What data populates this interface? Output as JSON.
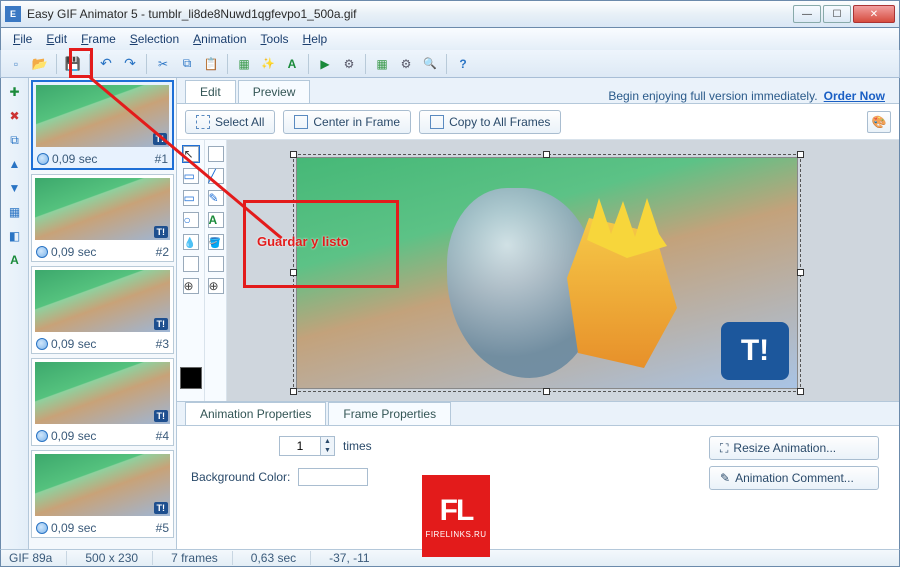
{
  "title": "Easy GIF Animator 5 - tumblr_li8de8Nuwd1qgfevpo1_500a.gif",
  "menu": [
    "File",
    "Edit",
    "Frame",
    "Selection",
    "Animation",
    "Tools",
    "Help"
  ],
  "frames": [
    {
      "duration": "0,09 sec",
      "num": "#1",
      "selected": true
    },
    {
      "duration": "0,09 sec",
      "num": "#2"
    },
    {
      "duration": "0,09 sec",
      "num": "#3"
    },
    {
      "duration": "0,09 sec",
      "num": "#4"
    },
    {
      "duration": "0,09 sec",
      "num": "#5"
    }
  ],
  "tabs": {
    "edit": "Edit",
    "preview": "Preview"
  },
  "promo": {
    "text": "Begin enjoying full version immediately.",
    "link": "Order Now"
  },
  "actions": {
    "selectAll": "Select All",
    "center": "Center in Frame",
    "copyAll": "Copy to All Frames"
  },
  "bottom": {
    "tabAnim": "Animation Properties",
    "tabFrame": "Frame Properties",
    "timesVal": "1",
    "timesLabel": "times",
    "bgLabel": "Background Color:",
    "resize": "Resize Animation...",
    "comment": "Animation Comment..."
  },
  "annotation": {
    "boxText": "Guardar y listo"
  },
  "status": {
    "ver": "GIF 89a",
    "dim": "500 x 230",
    "frames": "7 frames",
    "dur": "0,63 sec",
    "coords": "-37,  -11"
  },
  "watermark": {
    "big": "FL",
    "small": "FIRELINKS.RU"
  },
  "canvas": {
    "logo": "T!"
  }
}
